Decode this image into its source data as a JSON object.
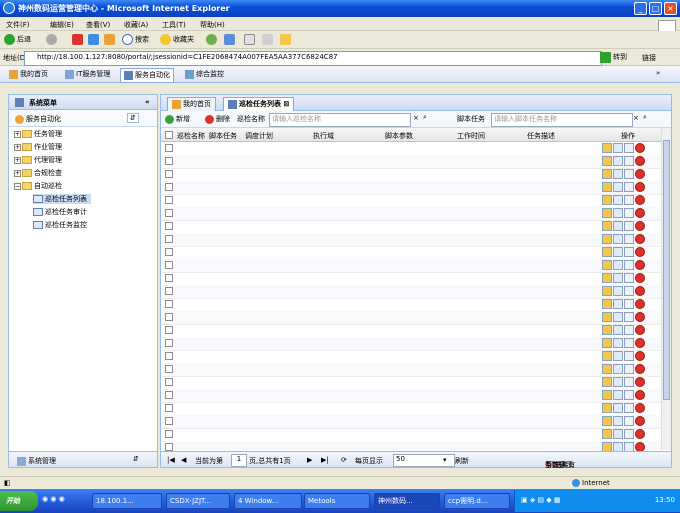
{
  "window": {
    "title": "神州数码运营管理中心 - Microsoft Internet Explorer"
  },
  "menu": [
    "文件(F)",
    "编辑(E)",
    "查看(V)",
    "收藏(A)",
    "工具(T)",
    "帮助(H)"
  ],
  "toolbar": {
    "back": "后退",
    "search": "搜索",
    "favorites": "收藏夹"
  },
  "address": {
    "label": "地址(D)",
    "url": "http://18.100.1.127:8080/portal/;jsessionid=C1FE2068474A007FEA5AA377C6824C87",
    "go": "转到",
    "links": "链接"
  },
  "apptabs": [
    "我的首页",
    "IT服务管理",
    "服务自动化",
    "综合监控"
  ],
  "sidebar": {
    "title": "系统菜单",
    "sub": "服务自动化",
    "tree": [
      {
        "label": "任务管理",
        "type": "folder"
      },
      {
        "label": "作业管理",
        "type": "folder"
      },
      {
        "label": "代理管理",
        "type": "folder"
      },
      {
        "label": "合规检查",
        "type": "folder"
      },
      {
        "label": "自动巡检",
        "type": "folder-open"
      },
      {
        "label": "巡检任务列表",
        "type": "leaf"
      },
      {
        "label": "巡检任务审计",
        "type": "leaf"
      },
      {
        "label": "巡检任务监控",
        "type": "leaf"
      }
    ],
    "footer": "系统管理"
  },
  "main": {
    "tabs": [
      "我的首页",
      "巡检任务列表"
    ],
    "toolbar": {
      "add": "新增",
      "delete": "删除",
      "name_label": "巡检名称",
      "name_placeholder": "请输入巡检名称",
      "script_label": "脚本任务",
      "script_placeholder": "请输入脚本任务名称"
    },
    "columns": [
      "巡检名称",
      "脚本任务",
      "调度计划",
      "执行域",
      "脚本参数",
      "工作时间",
      "任务描述",
      "操作"
    ],
    "rows": [
      {
        "c0": "",
        "c1": "",
        "c2": "",
        "c3": "",
        "c5": ""
      },
      {
        "c0": "",
        "c1": "",
        "c2": "",
        "c3": "",
        "c5": ""
      },
      {
        "c0": "",
        "c1": "",
        "c2": "",
        "c3": "",
        "c5": ""
      },
      {
        "c0": "",
        "c1": "",
        "c2": "",
        "c3": "",
        "c5": ""
      },
      {
        "c0": "",
        "c1": "",
        "c2": "",
        "c3": "",
        "c5": ""
      },
      {
        "c0": "",
        "c1": "",
        "c2": "",
        "c3": "",
        "c5": ""
      },
      {
        "c0": "",
        "c1": "",
        "c2": "",
        "c3": "",
        "c5": ""
      },
      {
        "c0": "",
        "c1": "",
        "c2": "",
        "c3": "",
        "c5": ""
      },
      {
        "c0": "",
        "c1": "",
        "c2": "",
        "c3": "",
        "c5": ""
      },
      {
        "c0": "",
        "c1": "",
        "c2": "",
        "c3": "",
        "c5": ""
      },
      {
        "c0": "",
        "c1": "",
        "c2": "",
        "c3": "",
        "c5": ""
      },
      {
        "c0": "",
        "c1": "",
        "c2": "",
        "c3": "",
        "c5": ""
      },
      {
        "c0": "",
        "c1": "",
        "c2": "",
        "c3": "",
        "c5": ""
      },
      {
        "c0": "",
        "c1": "",
        "c2": "",
        "c3": "",
        "c5": ""
      },
      {
        "c0": "",
        "c1": "",
        "c2": "",
        "c3": "",
        "c5": ""
      },
      {
        "c0": "",
        "c1": "",
        "c2": "",
        "c3": "",
        "c5": ""
      },
      {
        "c0": "",
        "c1": "",
        "c2": "",
        "c3": "",
        "c5": ""
      },
      {
        "c0": "",
        "c1": "",
        "c2": "",
        "c3": "",
        "c5": ""
      },
      {
        "c0": "",
        "c1": "",
        "c2": "",
        "c3": "",
        "c5": ""
      },
      {
        "c0": "",
        "c1": "",
        "c2": "",
        "c3": "",
        "c5": ""
      },
      {
        "c0": "",
        "c1": "",
        "c2": "",
        "c3": "",
        "c5": ""
      },
      {
        "c0": "",
        "c1": "",
        "c2": "",
        "c3": "",
        "c5": ""
      },
      {
        "c0": "",
        "c1": "",
        "c2": "",
        "c3": "",
        "c5": ""
      },
      {
        "c0": "",
        "c1": "",
        "c2": "",
        "c3": "",
        "c5": ""
      }
    ],
    "pager": {
      "page_prefix": "当前为第",
      "page": "1",
      "page_suffix": "页,总共有1页",
      "per_page_label": "每页显示",
      "per_page": "50",
      "refresh": "刷新",
      "summary_prefix": "当前显示",
      "summary_range": "1 - 43",
      "summary_total": "43",
      "summary_middle": "条,总共有",
      "summary_suffix": "条数据"
    }
  },
  "status": {
    "zone": "Internet"
  },
  "taskbar": {
    "start": "开始",
    "tasks": [
      "18.100.1...",
      "CSDX-JZJT...",
      "4 Window...",
      "Metools",
      "神州数码...",
      "ccp需明.d..."
    ],
    "clock": "13:50"
  }
}
